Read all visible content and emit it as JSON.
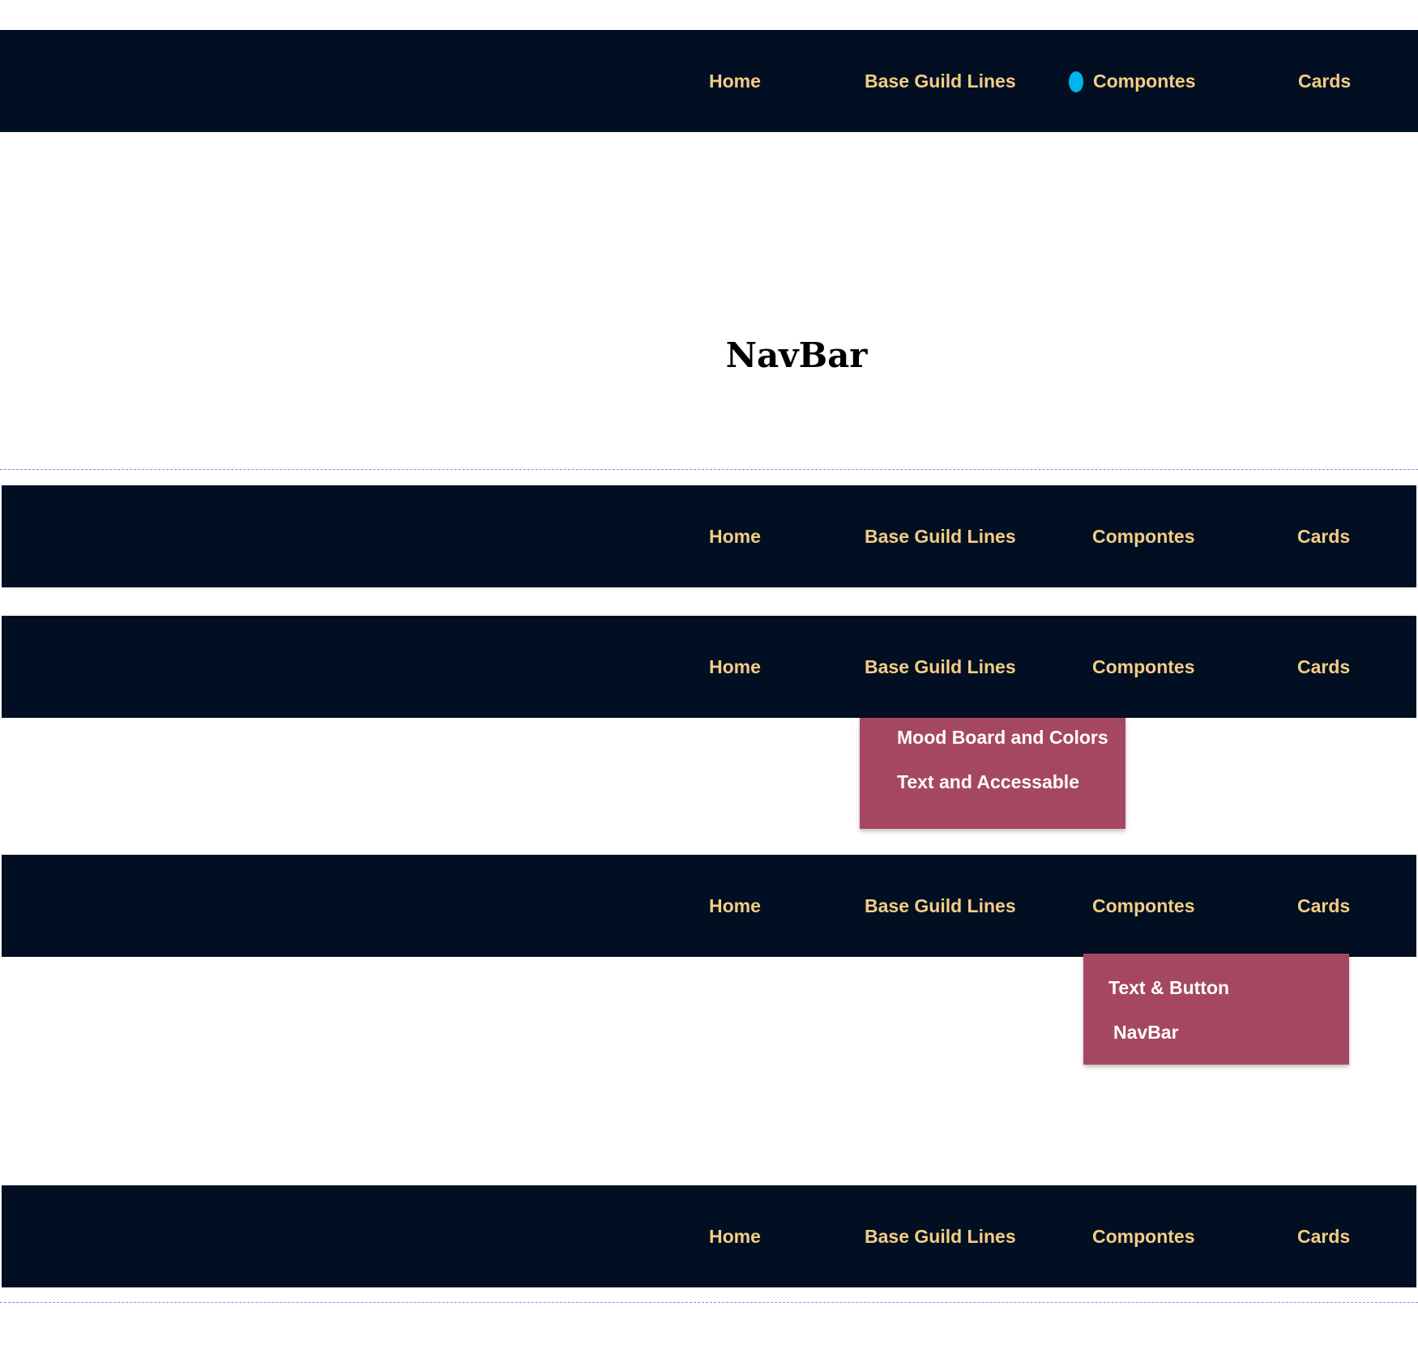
{
  "theme": {
    "navbar_bg": "#020f22",
    "nav_text": "#f3cd85",
    "dropdown_bg": "#a64761",
    "dropdown_text": "#ffffff",
    "divider": "#b072e0",
    "cursor_dot": "#00b4ee"
  },
  "nav_items": [
    "Home",
    "Base Guild Lines",
    "Compontes",
    "Cards"
  ],
  "page_title": "NavBar",
  "dropdowns": {
    "base_guidelines": [
      "Mood Board and Colors",
      "Text and Accessable"
    ],
    "components": [
      "Text & Button",
      "NavBar"
    ]
  },
  "cursor_icon": "pointer-dot-icon"
}
